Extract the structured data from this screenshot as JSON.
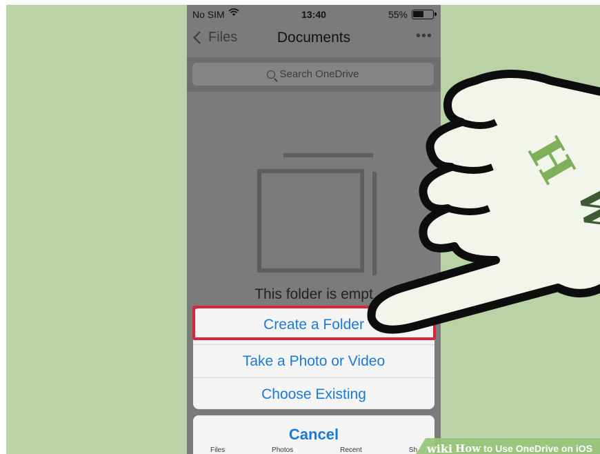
{
  "status_bar": {
    "carrier": "No SIM",
    "time": "13:40",
    "battery_percent": "55%"
  },
  "nav_bar": {
    "back_label": "Files",
    "title": "Documents",
    "more_label": "•••"
  },
  "search": {
    "placeholder": "Search OneDrive"
  },
  "empty_state": {
    "message": "This folder is empt"
  },
  "action_sheet": {
    "items": [
      {
        "label": "Create a Folder",
        "highlighted": true
      },
      {
        "label": "Take a Photo or Video",
        "highlighted": false
      },
      {
        "label": "Choose Existing",
        "highlighted": false
      }
    ],
    "cancel_label": "Cancel"
  },
  "tab_bar": {
    "items": [
      "Files",
      "Photos",
      "Recent",
      "Sh"
    ]
  },
  "watermark": {
    "logo_text": "wiki",
    "title_bold": "How",
    "title_rest": "to Use OneDrive on iOS",
    "hand_logo_text": "HW"
  },
  "colors": {
    "background": "#b9d3a6",
    "accent_blue": "#1a7ad8",
    "highlight_red": "#d9263a"
  },
  "icons": [
    "wifi-icon",
    "battery-icon",
    "chevron-left-icon",
    "more-icon",
    "search-icon",
    "empty-folder-icon",
    "pointing-hand-icon"
  ]
}
